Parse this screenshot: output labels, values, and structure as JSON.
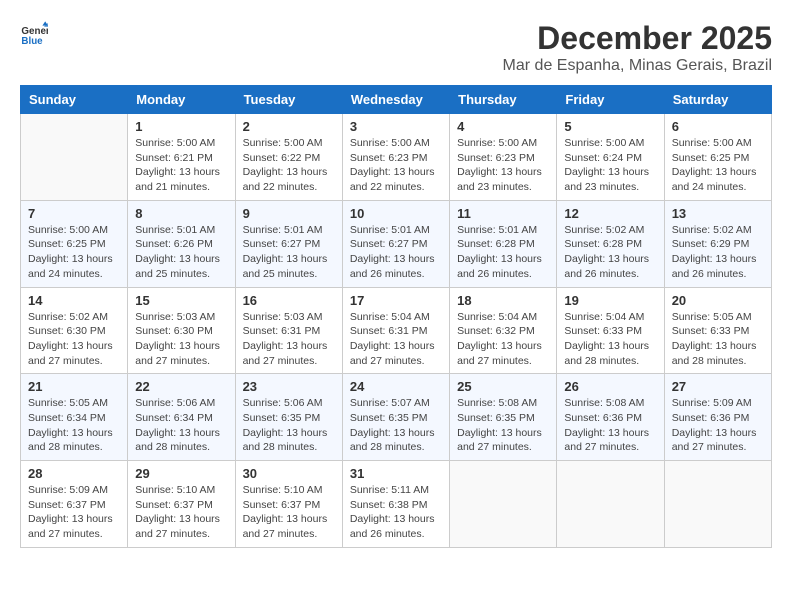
{
  "logo": {
    "line1": "General",
    "line2": "Blue"
  },
  "title": "December 2025",
  "subtitle": "Mar de Espanha, Minas Gerais, Brazil",
  "days_of_week": [
    "Sunday",
    "Monday",
    "Tuesday",
    "Wednesday",
    "Thursday",
    "Friday",
    "Saturday"
  ],
  "weeks": [
    [
      {
        "num": "",
        "info": ""
      },
      {
        "num": "1",
        "info": "Sunrise: 5:00 AM\nSunset: 6:21 PM\nDaylight: 13 hours\nand 21 minutes."
      },
      {
        "num": "2",
        "info": "Sunrise: 5:00 AM\nSunset: 6:22 PM\nDaylight: 13 hours\nand 22 minutes."
      },
      {
        "num": "3",
        "info": "Sunrise: 5:00 AM\nSunset: 6:23 PM\nDaylight: 13 hours\nand 22 minutes."
      },
      {
        "num": "4",
        "info": "Sunrise: 5:00 AM\nSunset: 6:23 PM\nDaylight: 13 hours\nand 23 minutes."
      },
      {
        "num": "5",
        "info": "Sunrise: 5:00 AM\nSunset: 6:24 PM\nDaylight: 13 hours\nand 23 minutes."
      },
      {
        "num": "6",
        "info": "Sunrise: 5:00 AM\nSunset: 6:25 PM\nDaylight: 13 hours\nand 24 minutes."
      }
    ],
    [
      {
        "num": "7",
        "info": "Sunrise: 5:00 AM\nSunset: 6:25 PM\nDaylight: 13 hours\nand 24 minutes."
      },
      {
        "num": "8",
        "info": "Sunrise: 5:01 AM\nSunset: 6:26 PM\nDaylight: 13 hours\nand 25 minutes."
      },
      {
        "num": "9",
        "info": "Sunrise: 5:01 AM\nSunset: 6:27 PM\nDaylight: 13 hours\nand 25 minutes."
      },
      {
        "num": "10",
        "info": "Sunrise: 5:01 AM\nSunset: 6:27 PM\nDaylight: 13 hours\nand 26 minutes."
      },
      {
        "num": "11",
        "info": "Sunrise: 5:01 AM\nSunset: 6:28 PM\nDaylight: 13 hours\nand 26 minutes."
      },
      {
        "num": "12",
        "info": "Sunrise: 5:02 AM\nSunset: 6:28 PM\nDaylight: 13 hours\nand 26 minutes."
      },
      {
        "num": "13",
        "info": "Sunrise: 5:02 AM\nSunset: 6:29 PM\nDaylight: 13 hours\nand 26 minutes."
      }
    ],
    [
      {
        "num": "14",
        "info": "Sunrise: 5:02 AM\nSunset: 6:30 PM\nDaylight: 13 hours\nand 27 minutes."
      },
      {
        "num": "15",
        "info": "Sunrise: 5:03 AM\nSunset: 6:30 PM\nDaylight: 13 hours\nand 27 minutes."
      },
      {
        "num": "16",
        "info": "Sunrise: 5:03 AM\nSunset: 6:31 PM\nDaylight: 13 hours\nand 27 minutes."
      },
      {
        "num": "17",
        "info": "Sunrise: 5:04 AM\nSunset: 6:31 PM\nDaylight: 13 hours\nand 27 minutes."
      },
      {
        "num": "18",
        "info": "Sunrise: 5:04 AM\nSunset: 6:32 PM\nDaylight: 13 hours\nand 27 minutes."
      },
      {
        "num": "19",
        "info": "Sunrise: 5:04 AM\nSunset: 6:33 PM\nDaylight: 13 hours\nand 28 minutes."
      },
      {
        "num": "20",
        "info": "Sunrise: 5:05 AM\nSunset: 6:33 PM\nDaylight: 13 hours\nand 28 minutes."
      }
    ],
    [
      {
        "num": "21",
        "info": "Sunrise: 5:05 AM\nSunset: 6:34 PM\nDaylight: 13 hours\nand 28 minutes."
      },
      {
        "num": "22",
        "info": "Sunrise: 5:06 AM\nSunset: 6:34 PM\nDaylight: 13 hours\nand 28 minutes."
      },
      {
        "num": "23",
        "info": "Sunrise: 5:06 AM\nSunset: 6:35 PM\nDaylight: 13 hours\nand 28 minutes."
      },
      {
        "num": "24",
        "info": "Sunrise: 5:07 AM\nSunset: 6:35 PM\nDaylight: 13 hours\nand 28 minutes."
      },
      {
        "num": "25",
        "info": "Sunrise: 5:08 AM\nSunset: 6:35 PM\nDaylight: 13 hours\nand 27 minutes."
      },
      {
        "num": "26",
        "info": "Sunrise: 5:08 AM\nSunset: 6:36 PM\nDaylight: 13 hours\nand 27 minutes."
      },
      {
        "num": "27",
        "info": "Sunrise: 5:09 AM\nSunset: 6:36 PM\nDaylight: 13 hours\nand 27 minutes."
      }
    ],
    [
      {
        "num": "28",
        "info": "Sunrise: 5:09 AM\nSunset: 6:37 PM\nDaylight: 13 hours\nand 27 minutes."
      },
      {
        "num": "29",
        "info": "Sunrise: 5:10 AM\nSunset: 6:37 PM\nDaylight: 13 hours\nand 27 minutes."
      },
      {
        "num": "30",
        "info": "Sunrise: 5:10 AM\nSunset: 6:37 PM\nDaylight: 13 hours\nand 27 minutes."
      },
      {
        "num": "31",
        "info": "Sunrise: 5:11 AM\nSunset: 6:38 PM\nDaylight: 13 hours\nand 26 minutes."
      },
      {
        "num": "",
        "info": ""
      },
      {
        "num": "",
        "info": ""
      },
      {
        "num": "",
        "info": ""
      }
    ]
  ]
}
